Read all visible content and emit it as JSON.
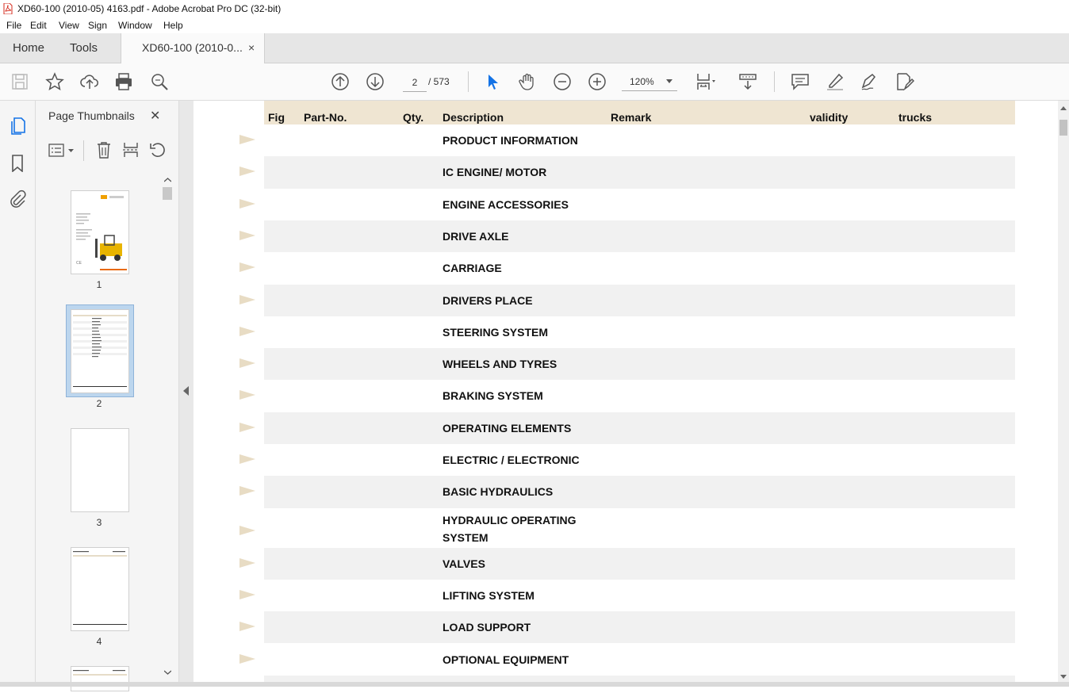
{
  "window": {
    "title": "XD60-100 (2010-05) 4163.pdf - Adobe Acrobat Pro DC (32-bit)"
  },
  "menu": [
    "File",
    "Edit",
    "View",
    "Sign",
    "Window",
    "Help"
  ],
  "tabs": {
    "home": "Home",
    "tools": "Tools",
    "document": "XD60-100 (2010-0...",
    "close": "×"
  },
  "toolbar": {
    "page_current": "2",
    "page_total": "/ 573",
    "zoom": "120%"
  },
  "thumbnail_panel": {
    "title": "Page Thumbnails",
    "close": "✕",
    "pages": [
      "1",
      "2",
      "3",
      "4"
    ],
    "selected_page": "2"
  },
  "table": {
    "headers": {
      "fig": "Fig",
      "part_no": "Part-No.",
      "qty": "Qty.",
      "description": "Description",
      "remark": "Remark",
      "validity": "validity",
      "trucks": "trucks"
    },
    "rows": [
      "PRODUCT INFORMATION",
      "IC ENGINE/ MOTOR",
      "ENGINE ACCESSORIES",
      "DRIVE AXLE",
      "CARRIAGE",
      "DRIVERS PLACE",
      "STEERING SYSTEM",
      "WHEELS AND TYRES",
      "BRAKING SYSTEM",
      "OPERATING ELEMENTS",
      "ELECTRIC / ELECTRONIC",
      "BASIC HYDRAULICS",
      "HYDRAULIC OPERATING SYSTEM",
      "VALVES",
      "LIFTING SYSTEM",
      "LOAD SUPPORT",
      "OPTIONAL EQUIPMENT"
    ]
  },
  "colors": {
    "header_bg": "#efe5d2",
    "row_shade": "#f1f1f1",
    "arrow": "#e8dcc4",
    "select_blue": "#1473e6"
  }
}
